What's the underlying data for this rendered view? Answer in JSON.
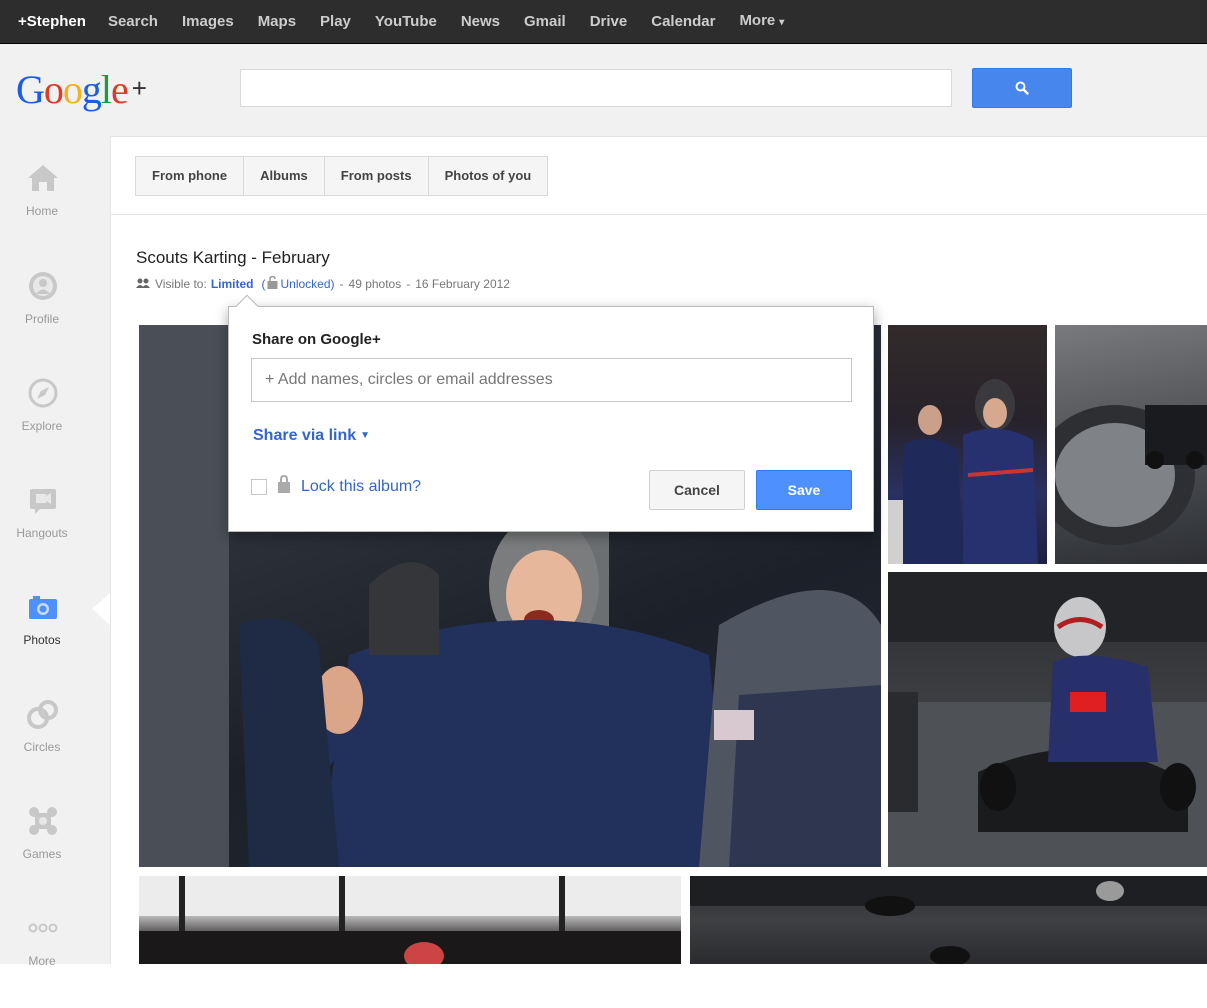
{
  "topbar": {
    "items": [
      {
        "label": "+Stephen"
      },
      {
        "label": "Search"
      },
      {
        "label": "Images"
      },
      {
        "label": "Maps"
      },
      {
        "label": "Play"
      },
      {
        "label": "YouTube"
      },
      {
        "label": "News"
      },
      {
        "label": "Gmail"
      },
      {
        "label": "Drive"
      },
      {
        "label": "Calendar"
      },
      {
        "label": "More"
      }
    ]
  },
  "header": {
    "logo_letters": [
      "G",
      "o",
      "o",
      "g",
      "l",
      "e"
    ],
    "logo_plus": "+",
    "search_value": ""
  },
  "leftnav": {
    "items": [
      {
        "label": "Home",
        "icon": "home-icon"
      },
      {
        "label": "Profile",
        "icon": "profile-icon"
      },
      {
        "label": "Explore",
        "icon": "explore-icon"
      },
      {
        "label": "Hangouts",
        "icon": "hangouts-icon"
      },
      {
        "label": "Photos",
        "icon": "photos-icon",
        "active": true
      },
      {
        "label": "Circles",
        "icon": "circles-icon"
      },
      {
        "label": "Games",
        "icon": "games-icon"
      },
      {
        "label": "More",
        "icon": "more-icon"
      }
    ]
  },
  "tabs": [
    {
      "label": "From phone"
    },
    {
      "label": "Albums"
    },
    {
      "label": "From posts"
    },
    {
      "label": "Photos of you"
    }
  ],
  "album": {
    "title": "Scouts Karting - February",
    "visible_prefix": "Visible to:",
    "visibility": "Limited",
    "open_paren": "(",
    "lock_state": "Unlocked)",
    "separator": "-",
    "photo_count": "49 photos",
    "separator2": "-",
    "date": "16 February 2012"
  },
  "share_dialog": {
    "title": "Share on Google+",
    "input_placeholder": "+ Add names, circles or email addresses",
    "share_link_label": "Share via link",
    "lock_label": "Lock this album?",
    "cancel_label": "Cancel",
    "save_label": "Save"
  },
  "colors": {
    "accent_blue": "#4d90fe",
    "link_blue": "#3366cc",
    "topbar_bg": "#2d2d2d"
  }
}
